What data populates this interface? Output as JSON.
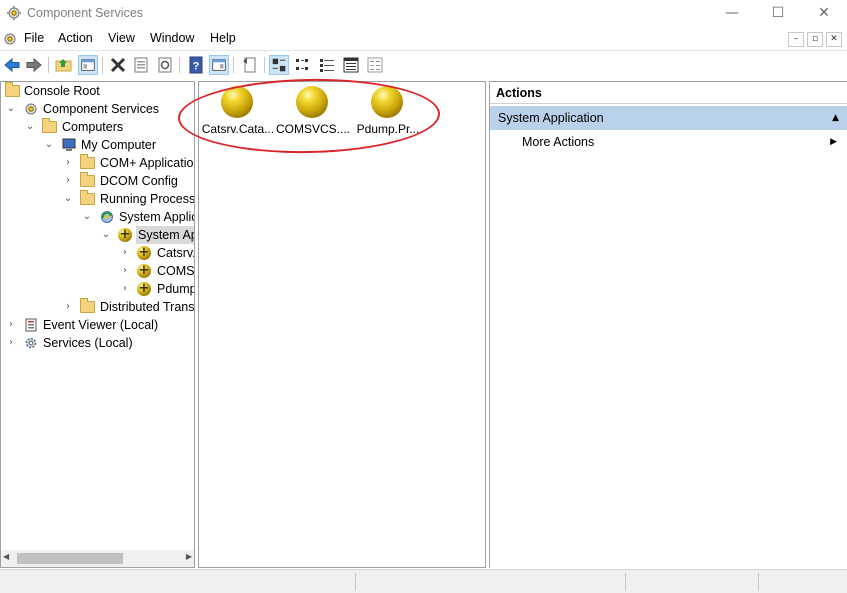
{
  "window": {
    "title": "Component Services",
    "controls": {
      "minimize": "—",
      "maximize": "☐",
      "close": "✕"
    }
  },
  "menubar": {
    "items": [
      "File",
      "Action",
      "View",
      "Window",
      "Help"
    ],
    "mdi": {
      "minimize": "–",
      "restore": "▫",
      "close": "✕"
    }
  },
  "toolbar": {
    "buttons": [
      "back",
      "forward",
      "up-one-level",
      "show-hide-console-tree",
      "delete",
      "properties",
      "refresh",
      "help",
      "show-hide-action-pane",
      "export-list",
      "large-icons",
      "small-icons",
      "list",
      "detail",
      "status-view"
    ]
  },
  "tree": {
    "items": [
      {
        "label": "Console Root",
        "icon": "folder-icon",
        "chevron": ""
      },
      {
        "label": "Component Services",
        "icon": "component-services-icon",
        "chevron": "⌄"
      },
      {
        "label": "Computers",
        "icon": "folder-icon",
        "chevron": "⌄"
      },
      {
        "label": "My Computer",
        "icon": "computer-icon",
        "chevron": "⌄"
      },
      {
        "label": "COM+ Applicatio",
        "icon": "folder-icon",
        "chevron": "›"
      },
      {
        "label": "DCOM Config",
        "icon": "folder-icon",
        "chevron": "›"
      },
      {
        "label": "Running Processe",
        "icon": "folder-icon",
        "chevron": "⌄"
      },
      {
        "label": "System Applic",
        "icon": "process-icon",
        "chevron": "⌄"
      },
      {
        "label": "System Ap",
        "icon": "component-ball-icon",
        "chevron": "⌄"
      },
      {
        "label": "Catsrv.",
        "icon": "component-ball-icon",
        "chevron": "›"
      },
      {
        "label": "COMS'",
        "icon": "component-ball-icon",
        "chevron": "›"
      },
      {
        "label": "Pdump",
        "icon": "component-ball-icon",
        "chevron": "›"
      },
      {
        "label": "Distributed Transa",
        "icon": "folder-icon",
        "chevron": "›"
      },
      {
        "label": "Event Viewer (Local)",
        "icon": "event-viewer-icon",
        "chevron": "›"
      },
      {
        "label": "Services (Local)",
        "icon": "gear-icon",
        "chevron": "›"
      }
    ]
  },
  "content": {
    "items": [
      {
        "label": "Catsrv.Cata..."
      },
      {
        "label": "COMSVCS...."
      },
      {
        "label": "Pdump.Pr..."
      }
    ]
  },
  "actions": {
    "header": "Actions",
    "section": "System Application",
    "section_collapse": "▲",
    "more": "More Actions",
    "more_arrow": "▶"
  },
  "colors": {
    "selection_bg": "#b9d1ea",
    "annotation_circle": "#d9262b"
  }
}
